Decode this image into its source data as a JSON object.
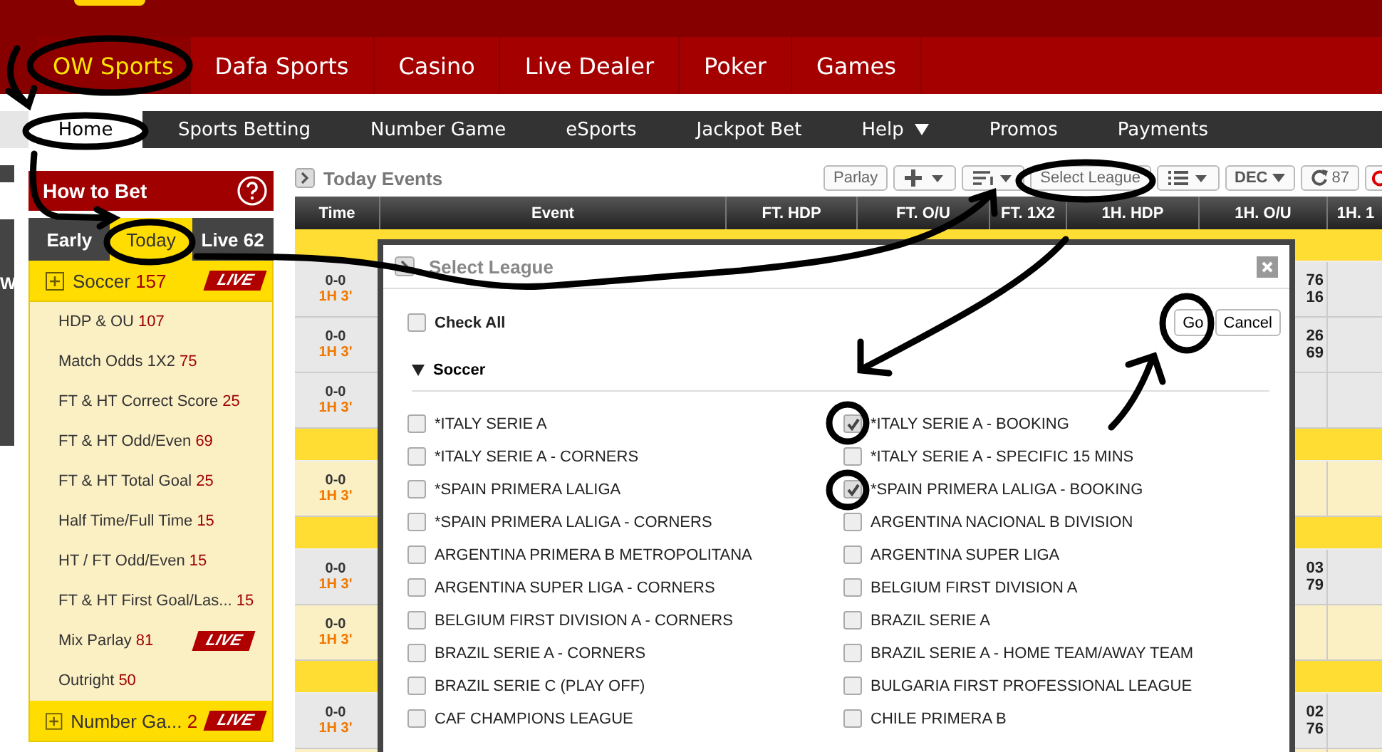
{
  "top_nav": [
    {
      "label": "OW Sports",
      "selected": true
    },
    {
      "label": "Dafa Sports",
      "selected": false
    },
    {
      "label": "Casino",
      "selected": false
    },
    {
      "label": "Live Dealer",
      "selected": false
    },
    {
      "label": "Poker",
      "selected": false
    },
    {
      "label": "Games",
      "selected": false
    }
  ],
  "sub_nav": [
    {
      "label": "Home",
      "selected": true,
      "dropdown": false
    },
    {
      "label": "Sports Betting",
      "selected": false,
      "dropdown": false
    },
    {
      "label": "Number Game",
      "selected": false,
      "dropdown": false
    },
    {
      "label": "eSports",
      "selected": false,
      "dropdown": false
    },
    {
      "label": "Jackpot Bet",
      "selected": false,
      "dropdown": false
    },
    {
      "label": "Help",
      "selected": false,
      "dropdown": true
    },
    {
      "label": "Promos",
      "selected": false,
      "dropdown": false
    },
    {
      "label": "Payments",
      "selected": false,
      "dropdown": false
    }
  ],
  "side_widget": {
    "label": "W"
  },
  "how_to_bet": {
    "title": "How to Bet"
  },
  "sport_tabs": [
    {
      "label": "Early",
      "selected": false
    },
    {
      "label": "Today",
      "selected": true
    },
    {
      "label": "Live 62",
      "selected": false
    }
  ],
  "sports": [
    {
      "name": "Soccer",
      "count": "157",
      "live_badge": "LIVE",
      "items": [
        {
          "name": "HDP & OU",
          "count": "107"
        },
        {
          "name": "Match Odds 1X2",
          "count": "75"
        },
        {
          "name": "FT & HT Correct Score",
          "count": "25"
        },
        {
          "name": "FT & HT Odd/Even",
          "count": "69"
        },
        {
          "name": "FT & HT Total Goal",
          "count": "25"
        },
        {
          "name": "Half Time/Full Time",
          "count": "15"
        },
        {
          "name": "HT / FT Odd/Even",
          "count": "15"
        },
        {
          "name": "FT & HT First Goal/Las...",
          "count": "15"
        },
        {
          "name": "Mix Parlay",
          "count": "81",
          "live_badge": "LIVE"
        },
        {
          "name": "Outright",
          "count": "50"
        }
      ]
    },
    {
      "name": "Number Ga...",
      "count": "2",
      "live_badge": "LIVE"
    }
  ],
  "events_panel": {
    "title": "Today Events",
    "toolbar": [
      {
        "kind": "text",
        "label": "Parlay"
      },
      {
        "kind": "plus-menu"
      },
      {
        "kind": "sort-menu"
      },
      {
        "kind": "text",
        "label": "Select League"
      },
      {
        "kind": "list-menu"
      },
      {
        "kind": "odds-menu",
        "label": "DEC"
      },
      {
        "kind": "refresh",
        "label": "87"
      },
      {
        "kind": "partial"
      }
    ]
  },
  "table": {
    "columns": [
      "Time",
      "Event",
      "FT. HDP",
      "FT. O/U",
      "FT. 1X2",
      "1H. HDP",
      "1H. O/U",
      "1H. 1"
    ],
    "rows": [
      {
        "kind": "league"
      },
      {
        "kind": "event",
        "score": "0-0",
        "clock": "1H 3'",
        "odds": [
          "76",
          "16"
        ]
      },
      {
        "kind": "event",
        "score": "0-0",
        "clock": "1H 3'",
        "odds": [
          "26",
          "69"
        ]
      },
      {
        "kind": "event",
        "score": "0-0",
        "clock": "1H 3'"
      },
      {
        "kind": "league"
      },
      {
        "kind": "event-alt",
        "score": "0-0",
        "clock": "1H 3'"
      },
      {
        "kind": "league"
      },
      {
        "kind": "event",
        "score": "0-0",
        "clock": "1H 3'",
        "odds": [
          "03",
          "79"
        ]
      },
      {
        "kind": "event-alt",
        "score": "0-0",
        "clock": "1H 3'"
      },
      {
        "kind": "league"
      },
      {
        "kind": "event",
        "score": "0-0",
        "clock": "1H 3'",
        "odds": [
          "02",
          "76"
        ]
      },
      {
        "kind": "event-alt"
      }
    ]
  },
  "modal": {
    "title": "Select League",
    "check_all": {
      "label": "Check All",
      "checked": false
    },
    "buttons": [
      {
        "label": "Go"
      },
      {
        "label": "Cancel"
      }
    ],
    "group": {
      "label": "Soccer",
      "expanded": true
    },
    "leagues": [
      {
        "name": "*ITALY SERIE A",
        "checked": false
      },
      {
        "name": "*ITALY SERIE A - BOOKING",
        "checked": true
      },
      {
        "name": "*ITALY SERIE A - CORNERS",
        "checked": false
      },
      {
        "name": "*ITALY SERIE A - SPECIFIC 15 MINS",
        "checked": false
      },
      {
        "name": "*SPAIN PRIMERA LALIGA",
        "checked": false
      },
      {
        "name": "*SPAIN PRIMERA LALIGA - BOOKING",
        "checked": true
      },
      {
        "name": "*SPAIN PRIMERA LALIGA - CORNERS",
        "checked": false
      },
      {
        "name": "ARGENTINA NACIONAL B DIVISION",
        "checked": false
      },
      {
        "name": "ARGENTINA PRIMERA B METROPOLITANA",
        "checked": false
      },
      {
        "name": "ARGENTINA SUPER LIGA",
        "checked": false
      },
      {
        "name": "ARGENTINA SUPER LIGA - CORNERS",
        "checked": false
      },
      {
        "name": "BELGIUM FIRST DIVISION A",
        "checked": false
      },
      {
        "name": "BELGIUM FIRST DIVISION A - CORNERS",
        "checked": false
      },
      {
        "name": "BRAZIL SERIE A",
        "checked": false
      },
      {
        "name": "BRAZIL SERIE A - CORNERS",
        "checked": false
      },
      {
        "name": "BRAZIL SERIE A - HOME TEAM/AWAY TEAM",
        "checked": false
      },
      {
        "name": "BRAZIL SERIE C (PLAY OFF)",
        "checked": false
      },
      {
        "name": "BULGARIA FIRST PROFESSIONAL LEAGUE",
        "checked": false
      },
      {
        "name": "CAF CHAMPIONS LEAGUE",
        "checked": false
      },
      {
        "name": "CHILE PRIMERA B",
        "checked": false
      }
    ]
  }
}
